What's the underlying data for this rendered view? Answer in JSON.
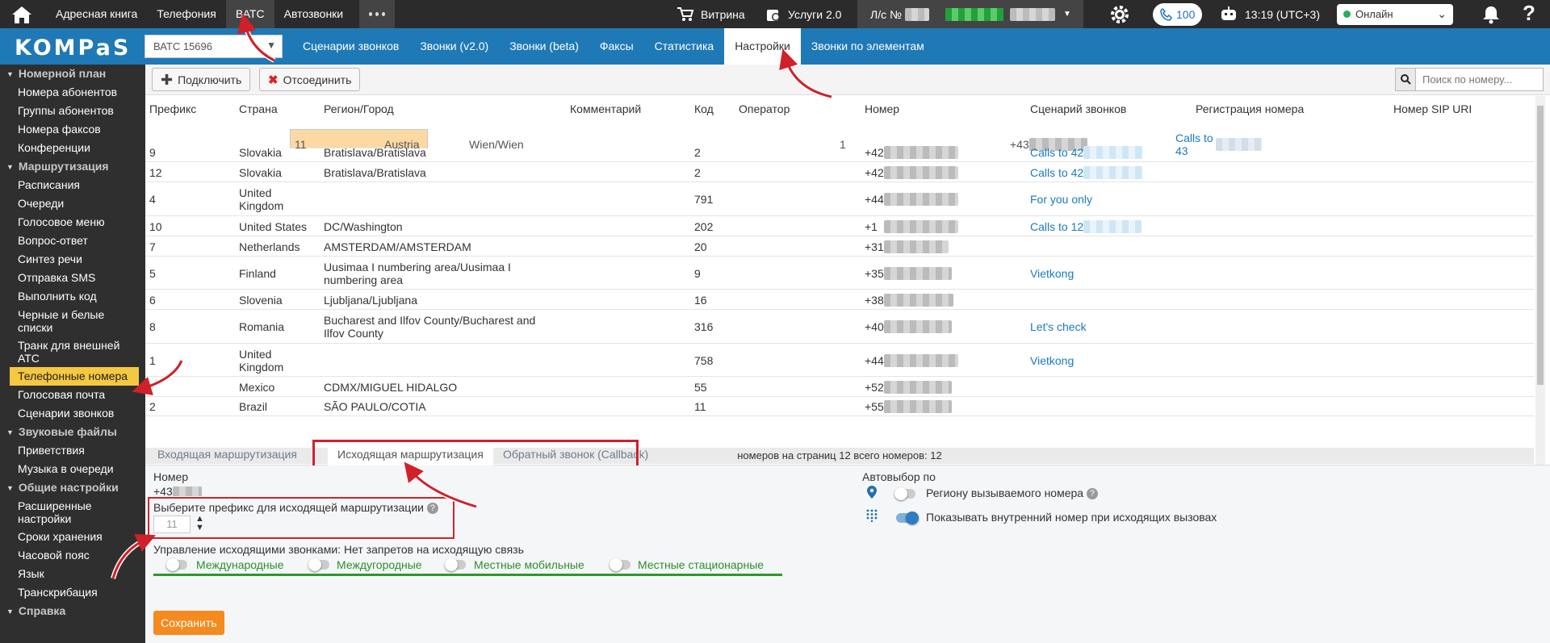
{
  "topbar": {
    "nav": [
      "Адресная книга",
      "Телефония",
      "ВАТС",
      "Автозвонки"
    ],
    "vitrina": "Витрина",
    "services": "Услуги 2.0",
    "account_prefix": "Л/с №",
    "calls_count": "100",
    "time": "13:19 (UTC+3)",
    "status": "Онлайн"
  },
  "navbar": {
    "logo": "KOMPaS",
    "pbx_select": "ВАТС 15696",
    "tabs": [
      "Сценарии звонков",
      "Звонки (v2.0)",
      "Звонки (beta)",
      "Факсы",
      "Статистика",
      "Настройки",
      "Звонки по элементам"
    ]
  },
  "sidebar": {
    "sections": [
      {
        "title": "Номерной план",
        "items": [
          "Номера абонентов",
          "Группы абонентов",
          "Номера факсов",
          "Конференции"
        ]
      },
      {
        "title": "Маршрутизация",
        "items": [
          "Расписания",
          "Очереди",
          "Голосовое меню",
          "Вопрос-ответ",
          "Синтез речи",
          "Отправка SMS",
          "Выполнить код",
          "Черные и белые списки",
          "Транк для внешней АТС",
          "Телефонные номера",
          "Голосовая почта",
          "Сценарии звонков"
        ]
      },
      {
        "title": "Звуковые файлы",
        "items": [
          "Приветствия",
          "Музыка в очереди"
        ]
      },
      {
        "title": "Общие настройки",
        "items": [
          "Расширенные настройки",
          "Сроки хранения",
          "Часовой пояс",
          "Язык",
          "Транскрибация"
        ]
      },
      {
        "title": "Справка",
        "items": []
      }
    ]
  },
  "toolbar": {
    "connect": "Подключить",
    "disconnect": "Отсоединить",
    "search_placeholder": "Поиск по номеру..."
  },
  "table": {
    "columns": [
      "Префикс",
      "Страна",
      "Регион/Город",
      "Комментарий",
      "Код",
      "Оператор",
      "Номер",
      "Сценарий звонков",
      "Регистрация номера",
      "Номер SIP URI"
    ],
    "rows": [
      {
        "prefix": "11",
        "country": "Austria",
        "region": "Wien/Wien",
        "code": "1",
        "number": "+43",
        "scenario": "Calls to 43"
      },
      {
        "prefix": "9",
        "country": "Slovakia",
        "region": "Bratislava/Bratislava",
        "code": "2",
        "number": "+42",
        "scenario": "Calls to 42"
      },
      {
        "prefix": "12",
        "country": "Slovakia",
        "region": "Bratislava/Bratislava",
        "code": "2",
        "number": "+42",
        "scenario": "Calls to 42"
      },
      {
        "prefix": "4",
        "country": "United Kingdom",
        "region": "",
        "code": "791",
        "number": "+44",
        "scenario": "For you only"
      },
      {
        "prefix": "10",
        "country": "United States",
        "region": "DC/Washington",
        "code": "202",
        "number": "+1",
        "scenario": "Calls to 12"
      },
      {
        "prefix": "7",
        "country": "Netherlands",
        "region": "AMSTERDAM/AMSTERDAM",
        "code": "20",
        "number": "+31",
        "scenario": ""
      },
      {
        "prefix": "5",
        "country": "Finland",
        "region": "Uusimaa I numbering area/Uusimaa I numbering area",
        "code": "9",
        "number": "+35",
        "scenario": "Vietkong"
      },
      {
        "prefix": "6",
        "country": "Slovenia",
        "region": "Ljubljana/Ljubljana",
        "code": "16",
        "number": "+38",
        "scenario": ""
      },
      {
        "prefix": "8",
        "country": "Romania",
        "region": "Bucharest and Ilfov County/Bucharest and Ilfov County",
        "code": "316",
        "number": "+40",
        "scenario": "Let's check"
      },
      {
        "prefix": "1",
        "country": "United Kingdom",
        "region": "",
        "code": "758",
        "number": "+44",
        "scenario": "Vietkong"
      },
      {
        "prefix": "",
        "country": "Mexico",
        "region": "CDMX/MIGUEL HIDALGO",
        "code": "55",
        "number": "+52",
        "scenario": ""
      },
      {
        "prefix": "2",
        "country": "Brazil",
        "region": "SÃO PAULO/COTIA",
        "code": "11",
        "number": "+55",
        "scenario": ""
      }
    ],
    "footer": "номеров на страниц  12  всего номеров: 12"
  },
  "tabs": [
    "Входящая маршрутизация",
    "Исходящая маршрутизация",
    "Обратный звонок (Callback)"
  ],
  "panel": {
    "number_label": "Номер",
    "number_value": "+43",
    "prefix_label": "Выберите префикс для исходящей маршрутизации",
    "prefix_value": "11",
    "calls_mgmt": "Управление исходящими звонками: Нет запретов на исходящую связь",
    "restrictions": [
      "Международные",
      "Междугородные",
      "Местные мобильные",
      "Местные стационарные"
    ],
    "auto_select": "Автовыбор по",
    "by_region": "Региону вызываемого номера",
    "show_internal": "Показывать внутренний номер при исходящих вызовах",
    "save": "Сохранить"
  }
}
